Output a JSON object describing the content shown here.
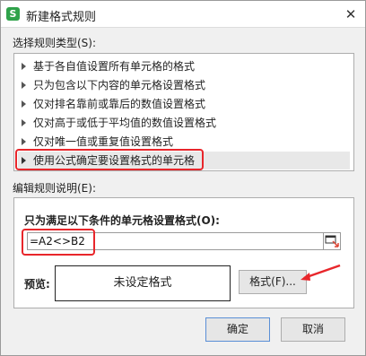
{
  "window": {
    "title": "新建格式规则",
    "app_icon_letter": "S"
  },
  "rule_type": {
    "label": "选择规则类型(S):",
    "items": [
      "基于各自值设置所有单元格的格式",
      "只为包含以下内容的单元格设置格式",
      "仅对排名靠前或靠后的数值设置格式",
      "仅对高于或低于平均值的数值设置格式",
      "仅对唯一值或重复值设置格式",
      "使用公式确定要设置格式的单元格"
    ],
    "selected_index": 5
  },
  "rule_desc": {
    "label": "编辑规则说明(E):",
    "formula_label": "只为满足以下条件的单元格设置格式(O):",
    "formula_value": "=A2<>B2",
    "preview_label": "预览:",
    "preview_text": "未设定格式",
    "format_button": "格式(F)..."
  },
  "buttons": {
    "ok": "确定",
    "cancel": "取消"
  },
  "colors": {
    "annotation_red": "#e8262b",
    "app_green": "#2fa24a"
  }
}
